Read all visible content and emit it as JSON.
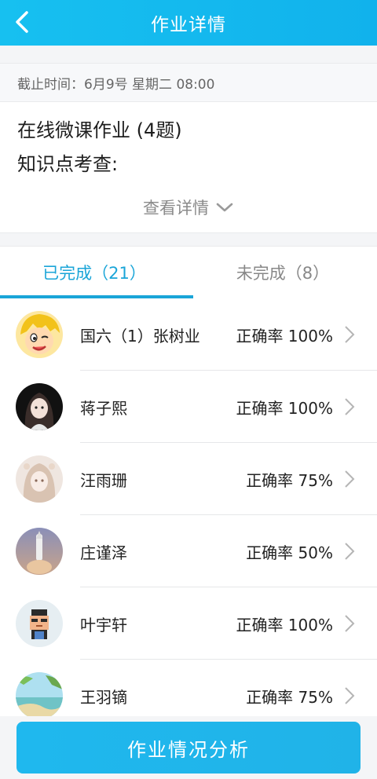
{
  "header": {
    "title": "作业详情",
    "back_icon": "chevron-left-icon"
  },
  "deadline": {
    "text": "截止时间：6月9号 星期二 08:00"
  },
  "assignment": {
    "title": "在线微课作业 (4题)",
    "knowledge_label": "知识点考查:",
    "view_detail_label": "查看详情",
    "view_detail_icon": "chevron-down-icon"
  },
  "tabs": [
    {
      "label": "已完成（21）",
      "active": true
    },
    {
      "label": "未完成（8）",
      "active": false
    }
  ],
  "students": [
    {
      "name": "国六（1）张树业",
      "accuracy": "正确率 100%",
      "avatar": "cartoon-face-avatar"
    },
    {
      "name": "蒋子熙",
      "accuracy": "正确率 100%",
      "avatar": "anime-girl-avatar"
    },
    {
      "name": "汪雨珊",
      "accuracy": "正确率 75%",
      "avatar": "anime-girl-light-avatar"
    },
    {
      "name": "庄谨泽",
      "accuracy": "正确率 50%",
      "avatar": "rocket-avatar"
    },
    {
      "name": "叶宇轩",
      "accuracy": "正确率 100%",
      "avatar": "pixel-character-avatar"
    },
    {
      "name": "王羽镝",
      "accuracy": "正确率 75%",
      "avatar": "landscape-avatar"
    }
  ],
  "footer": {
    "analyze_button_label": "作业情况分析"
  },
  "colors": {
    "accent": "#1aa5d8",
    "header": "#17c0f0"
  }
}
